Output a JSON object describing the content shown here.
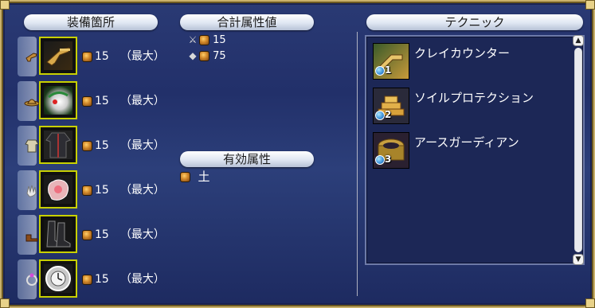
{
  "headers": {
    "equipment": "装備箇所",
    "total_attributes": "合計属性値",
    "effective_attributes": "有効属性",
    "technique": "テクニック"
  },
  "equipment_slots": [
    {
      "slot_icon": "pistol-slot-icon",
      "item_icon": "flintlock-pistol-icon",
      "value": "15",
      "max_label": "（最大）"
    },
    {
      "slot_icon": "hat-slot-icon",
      "item_icon": "feathered-hat-icon",
      "value": "15",
      "max_label": "（最大）"
    },
    {
      "slot_icon": "coat-slot-icon",
      "item_icon": "dark-coat-icon",
      "value": "15",
      "max_label": "（最大）"
    },
    {
      "slot_icon": "glove-slot-icon",
      "item_icon": "pink-glove-icon",
      "value": "15",
      "max_label": "（最大）"
    },
    {
      "slot_icon": "boot-slot-icon",
      "item_icon": "black-boots-icon",
      "value": "15",
      "max_label": "（最大）"
    },
    {
      "slot_icon": "ring-slot-icon",
      "item_icon": "pocket-watch-icon",
      "value": "15",
      "max_label": "（最大）"
    }
  ],
  "total_attributes": [
    {
      "icon": "sword-icon",
      "value": "15"
    },
    {
      "icon": "shield-icon",
      "value": "75"
    }
  ],
  "effective_attribute": {
    "label": "土"
  },
  "techniques": [
    {
      "name": "クレイカウンター",
      "level": "1",
      "icon": "clay-counter-icon"
    },
    {
      "name": "ソイルプロテクション",
      "level": "2",
      "icon": "soil-protection-icon"
    },
    {
      "name": "アースガーディアン",
      "level": "3",
      "icon": "earth-guardian-icon"
    }
  ],
  "colors": {
    "panel_bg": "#22306a",
    "gold_border": "#c9b06a",
    "slot_highlight": "#c8d000",
    "attribute_gem": "#d2882a",
    "tech_list_bg": "#1c2756"
  }
}
